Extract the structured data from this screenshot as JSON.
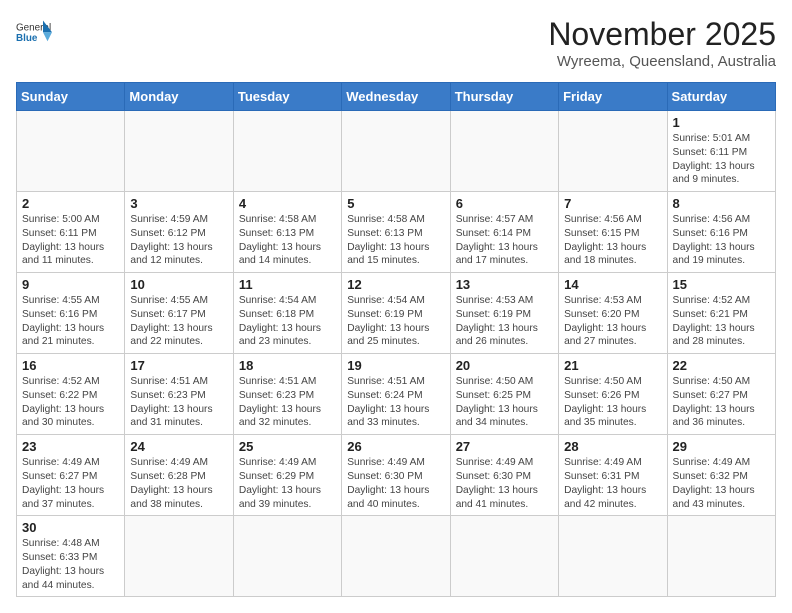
{
  "header": {
    "logo_general": "General",
    "logo_blue": "Blue",
    "month_title": "November 2025",
    "location": "Wyreema, Queensland, Australia"
  },
  "weekdays": [
    "Sunday",
    "Monday",
    "Tuesday",
    "Wednesday",
    "Thursday",
    "Friday",
    "Saturday"
  ],
  "weeks": [
    [
      {
        "day": "",
        "info": ""
      },
      {
        "day": "",
        "info": ""
      },
      {
        "day": "",
        "info": ""
      },
      {
        "day": "",
        "info": ""
      },
      {
        "day": "",
        "info": ""
      },
      {
        "day": "",
        "info": ""
      },
      {
        "day": "1",
        "info": "Sunrise: 5:01 AM\nSunset: 6:11 PM\nDaylight: 13 hours\nand 9 minutes."
      }
    ],
    [
      {
        "day": "2",
        "info": "Sunrise: 5:00 AM\nSunset: 6:11 PM\nDaylight: 13 hours\nand 11 minutes."
      },
      {
        "day": "3",
        "info": "Sunrise: 4:59 AM\nSunset: 6:12 PM\nDaylight: 13 hours\nand 12 minutes."
      },
      {
        "day": "4",
        "info": "Sunrise: 4:58 AM\nSunset: 6:13 PM\nDaylight: 13 hours\nand 14 minutes."
      },
      {
        "day": "5",
        "info": "Sunrise: 4:58 AM\nSunset: 6:13 PM\nDaylight: 13 hours\nand 15 minutes."
      },
      {
        "day": "6",
        "info": "Sunrise: 4:57 AM\nSunset: 6:14 PM\nDaylight: 13 hours\nand 17 minutes."
      },
      {
        "day": "7",
        "info": "Sunrise: 4:56 AM\nSunset: 6:15 PM\nDaylight: 13 hours\nand 18 minutes."
      },
      {
        "day": "8",
        "info": "Sunrise: 4:56 AM\nSunset: 6:16 PM\nDaylight: 13 hours\nand 19 minutes."
      }
    ],
    [
      {
        "day": "9",
        "info": "Sunrise: 4:55 AM\nSunset: 6:16 PM\nDaylight: 13 hours\nand 21 minutes."
      },
      {
        "day": "10",
        "info": "Sunrise: 4:55 AM\nSunset: 6:17 PM\nDaylight: 13 hours\nand 22 minutes."
      },
      {
        "day": "11",
        "info": "Sunrise: 4:54 AM\nSunset: 6:18 PM\nDaylight: 13 hours\nand 23 minutes."
      },
      {
        "day": "12",
        "info": "Sunrise: 4:54 AM\nSunset: 6:19 PM\nDaylight: 13 hours\nand 25 minutes."
      },
      {
        "day": "13",
        "info": "Sunrise: 4:53 AM\nSunset: 6:19 PM\nDaylight: 13 hours\nand 26 minutes."
      },
      {
        "day": "14",
        "info": "Sunrise: 4:53 AM\nSunset: 6:20 PM\nDaylight: 13 hours\nand 27 minutes."
      },
      {
        "day": "15",
        "info": "Sunrise: 4:52 AM\nSunset: 6:21 PM\nDaylight: 13 hours\nand 28 minutes."
      }
    ],
    [
      {
        "day": "16",
        "info": "Sunrise: 4:52 AM\nSunset: 6:22 PM\nDaylight: 13 hours\nand 30 minutes."
      },
      {
        "day": "17",
        "info": "Sunrise: 4:51 AM\nSunset: 6:23 PM\nDaylight: 13 hours\nand 31 minutes."
      },
      {
        "day": "18",
        "info": "Sunrise: 4:51 AM\nSunset: 6:23 PM\nDaylight: 13 hours\nand 32 minutes."
      },
      {
        "day": "19",
        "info": "Sunrise: 4:51 AM\nSunset: 6:24 PM\nDaylight: 13 hours\nand 33 minutes."
      },
      {
        "day": "20",
        "info": "Sunrise: 4:50 AM\nSunset: 6:25 PM\nDaylight: 13 hours\nand 34 minutes."
      },
      {
        "day": "21",
        "info": "Sunrise: 4:50 AM\nSunset: 6:26 PM\nDaylight: 13 hours\nand 35 minutes."
      },
      {
        "day": "22",
        "info": "Sunrise: 4:50 AM\nSunset: 6:27 PM\nDaylight: 13 hours\nand 36 minutes."
      }
    ],
    [
      {
        "day": "23",
        "info": "Sunrise: 4:49 AM\nSunset: 6:27 PM\nDaylight: 13 hours\nand 37 minutes."
      },
      {
        "day": "24",
        "info": "Sunrise: 4:49 AM\nSunset: 6:28 PM\nDaylight: 13 hours\nand 38 minutes."
      },
      {
        "day": "25",
        "info": "Sunrise: 4:49 AM\nSunset: 6:29 PM\nDaylight: 13 hours\nand 39 minutes."
      },
      {
        "day": "26",
        "info": "Sunrise: 4:49 AM\nSunset: 6:30 PM\nDaylight: 13 hours\nand 40 minutes."
      },
      {
        "day": "27",
        "info": "Sunrise: 4:49 AM\nSunset: 6:30 PM\nDaylight: 13 hours\nand 41 minutes."
      },
      {
        "day": "28",
        "info": "Sunrise: 4:49 AM\nSunset: 6:31 PM\nDaylight: 13 hours\nand 42 minutes."
      },
      {
        "day": "29",
        "info": "Sunrise: 4:49 AM\nSunset: 6:32 PM\nDaylight: 13 hours\nand 43 minutes."
      }
    ],
    [
      {
        "day": "30",
        "info": "Sunrise: 4:48 AM\nSunset: 6:33 PM\nDaylight: 13 hours\nand 44 minutes."
      },
      {
        "day": "",
        "info": ""
      },
      {
        "day": "",
        "info": ""
      },
      {
        "day": "",
        "info": ""
      },
      {
        "day": "",
        "info": ""
      },
      {
        "day": "",
        "info": ""
      },
      {
        "day": "",
        "info": ""
      }
    ]
  ]
}
